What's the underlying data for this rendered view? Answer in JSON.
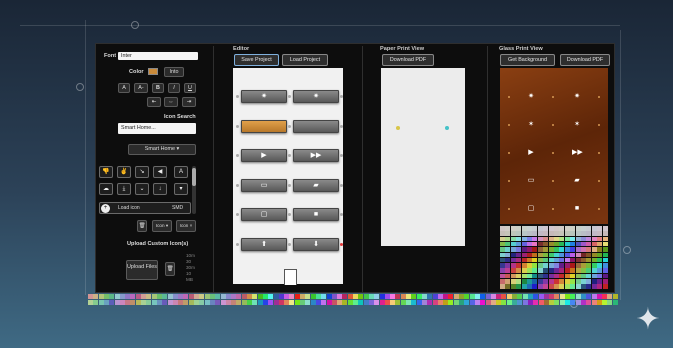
{
  "left_panel": {
    "font_label": "Font",
    "font_value": "Inter",
    "color_label": "Color",
    "color_value": "#c98a3a",
    "color_button": "Into",
    "format_buttons": [
      "A",
      "A-",
      "B",
      "I",
      "U"
    ],
    "align_buttons": [
      "⇤",
      "⇔",
      "⇥"
    ],
    "icon_search_label": "Icon Search",
    "icon_search_value": "Smart Home...",
    "category_select": "Smart Home",
    "grid_icons": [
      "thumbs-down-icon",
      "thumbs-icon",
      "trend-icon",
      "volume-icon",
      "text-a-icon",
      "cloud-upload-icon",
      "download-icon",
      "chevron-down-icon",
      "arrow-down-icon",
      "caret-down-icon"
    ],
    "load_icon_label": "Load icon",
    "load_icon_value": "SMD",
    "icon_select_1": "Icon ▾",
    "icon_select_2": "Icon ×",
    "upload_title": "Upload Custom Icon(s)",
    "upload_button": "Upload Files",
    "upload_hint": [
      "10m",
      "30",
      "30m",
      "10",
      "MB"
    ]
  },
  "editor": {
    "title": "Editor",
    "save_button": "Save Project",
    "load_button": "Load Project",
    "rows": [
      {
        "left": "✷",
        "right": "✷",
        "left_orange": false
      },
      {
        "left": "",
        "right": "",
        "left_orange": true
      },
      {
        "left": "▶",
        "right": "▶▶",
        "left_orange": false
      },
      {
        "left": "▭",
        "right": "▰",
        "left_orange": false
      },
      {
        "left": "▢",
        "right": "■",
        "left_orange": false
      },
      {
        "left": "⬆",
        "right": "⬇",
        "left_orange": false
      }
    ]
  },
  "paper_view": {
    "title": "Paper Print View",
    "download_button": "Download PDF"
  },
  "glass_view": {
    "title": "Glass Print View",
    "bg_button": "Get Background",
    "download_button": "Download PDF",
    "icons": [
      [
        "✷",
        "✷"
      ],
      [
        "✶",
        "✶"
      ],
      [
        "▶",
        "▶▶"
      ],
      [
        "▭",
        "▰"
      ],
      [
        "▢",
        "■"
      ]
    ]
  },
  "colors": {
    "accent": "#7fb0dd",
    "wood": "#6b2e0c",
    "orange": "#c98a3a"
  }
}
